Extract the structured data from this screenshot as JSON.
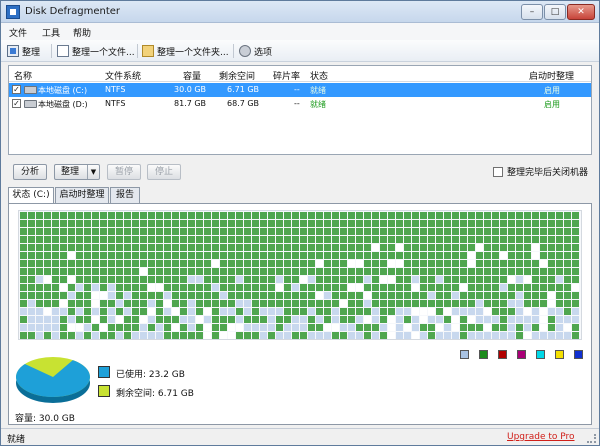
{
  "window": {
    "title": "Disk Defragmenter",
    "min_label": "–",
    "max_label": "□",
    "close_label": "✕"
  },
  "menu": [
    "文件",
    "工具",
    "帮助"
  ],
  "toolbar": {
    "defrag_label": "整理",
    "defrag_file_label": "整理一个文件...",
    "defrag_folder_label": "整理一个文件夹...",
    "options_label": "选项"
  },
  "list": {
    "headers": {
      "name": "名称",
      "fs": "文件系统",
      "capacity": "容量",
      "free": "剩余空间",
      "frag": "碎片率",
      "status": "状态",
      "boot": "启动时整理"
    },
    "rows": [
      {
        "checked": true,
        "name": "本地磁盘 (C:)",
        "fs": "NTFS",
        "capacity": "30.0 GB",
        "free": "6.71 GB",
        "frag": "--",
        "status": "就绪",
        "boot": "启用"
      },
      {
        "checked": true,
        "name": "本地磁盘 (D:)",
        "fs": "NTFS",
        "capacity": "81.7 GB",
        "free": "68.7 GB",
        "frag": "--",
        "status": "就绪",
        "boot": "启用"
      }
    ]
  },
  "actions": {
    "analyze": "分析",
    "defrag": "整理",
    "pause": "暂停",
    "stop": "停止",
    "shutdown_label": "整理完毕后关闭机器"
  },
  "tabs": [
    "状态 (C:)",
    "启动时整理",
    "报告"
  ],
  "cluster_map": {
    "colors": {
      "used": "#4fa64f",
      "free": "#c8d8ee",
      "empty": "#ffffff"
    }
  },
  "legend_colors": [
    "#a9c3e3",
    "#1b8a1b",
    "#b00000",
    "#aa0077",
    "#00d8e8",
    "#f5e000",
    "#1030d0"
  ],
  "usage": {
    "used_label": "已使用: 23.2 GB",
    "free_label": "剩余空间: 6.71 GB",
    "used_color": "#1ea0d8",
    "free_color": "#c8e232",
    "used_fraction": 0.773,
    "capacity_label": "容量: 30.0 GB"
  },
  "statusbar": {
    "text": "就绪",
    "link": "Upgrade to Pro"
  }
}
